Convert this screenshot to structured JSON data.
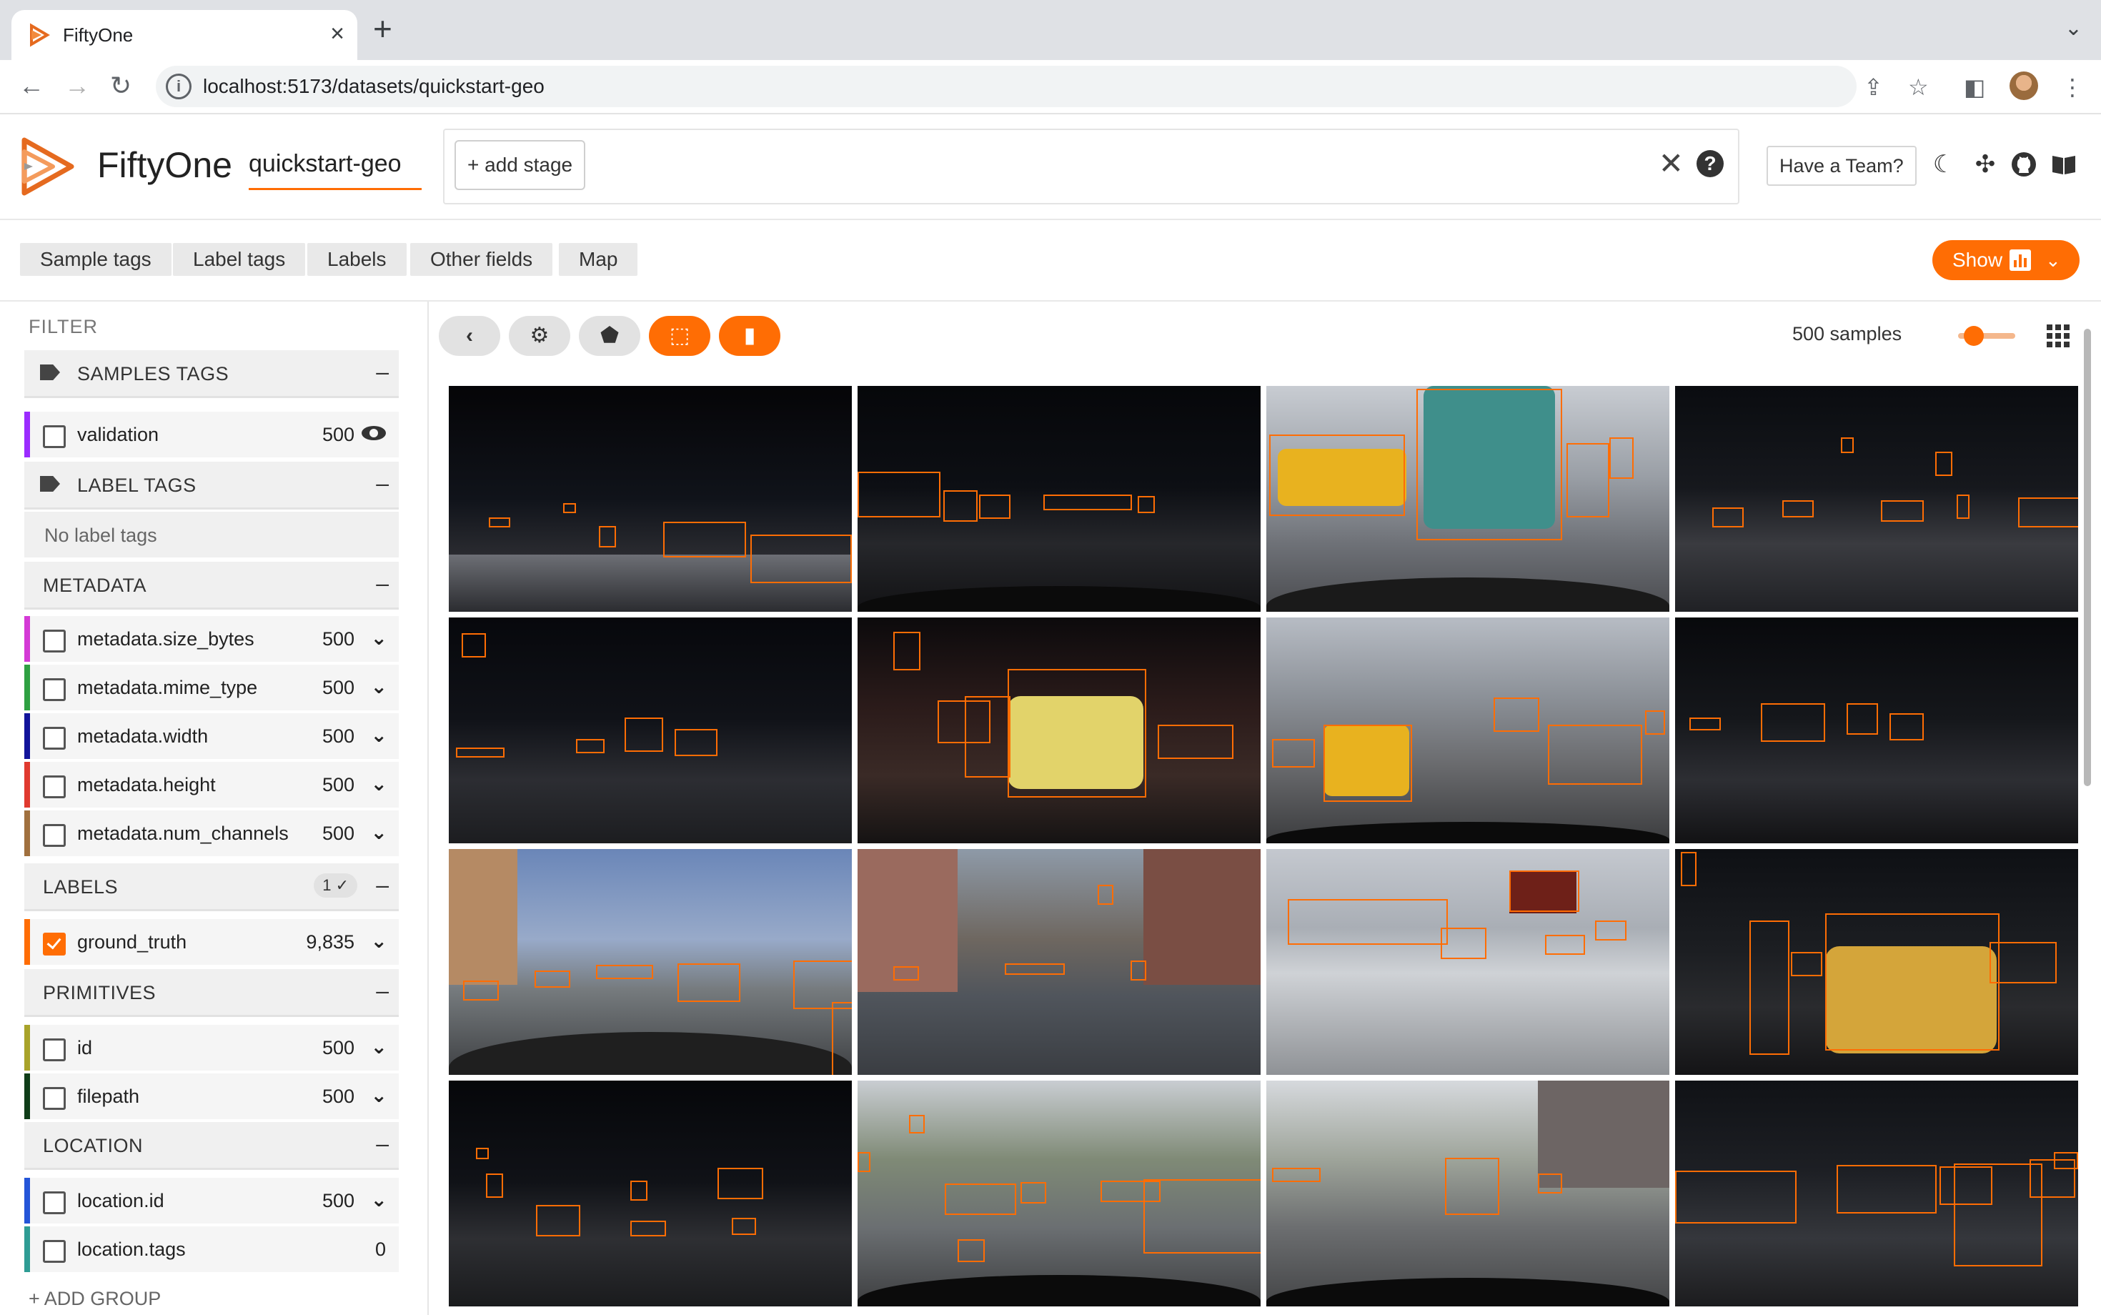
{
  "browser": {
    "tab_title": "FiftyOne",
    "url": "localhost:5173/datasets/quickstart-geo"
  },
  "header": {
    "app_name": "FiftyOne",
    "dataset_name": "quickstart-geo",
    "add_stage_label": "+ add stage",
    "team_button_label": "Have a Team?"
  },
  "tabs": {
    "items": [
      "Sample tags",
      "Label tags",
      "Labels",
      "Other fields",
      "Map"
    ],
    "show_label": "Show"
  },
  "sidebar": {
    "filter_label": "FILTER",
    "groups": {
      "samples_tags": "SAMPLES TAGS",
      "label_tags": "LABEL TAGS",
      "metadata": "METADATA",
      "labels": "LABELS",
      "primitives": "PRIMITIVES",
      "location": "LOCATION"
    },
    "labels_badge": "1 ✓",
    "no_label_tags": "No label tags",
    "add_group": "+ ADD GROUP",
    "rows": [
      {
        "label": "validation",
        "count": "500",
        "color": "#9b2bff"
      },
      {
        "label": "metadata.size_bytes",
        "count": "500",
        "color": "#d43ad6"
      },
      {
        "label": "metadata.mime_type",
        "count": "500",
        "color": "#2ea042"
      },
      {
        "label": "metadata.width",
        "count": "500",
        "color": "#12149a"
      },
      {
        "label": "metadata.height",
        "count": "500",
        "color": "#e03a2f"
      },
      {
        "label": "metadata.num_channels",
        "count": "500",
        "color": "#a0703e"
      },
      {
        "label": "ground_truth",
        "count": "9,835",
        "color": "#ff6d04"
      },
      {
        "label": "id",
        "count": "500",
        "color": "#a8a32a"
      },
      {
        "label": "filepath",
        "count": "500",
        "color": "#0f3d18"
      },
      {
        "label": "location.id",
        "count": "500",
        "color": "#2455d8"
      },
      {
        "label": "location.tags",
        "count": "0",
        "color": "#2e9c94"
      }
    ]
  },
  "grid": {
    "sample_count": "500 samples"
  },
  "colors": {
    "accent": "#ff6d04"
  }
}
